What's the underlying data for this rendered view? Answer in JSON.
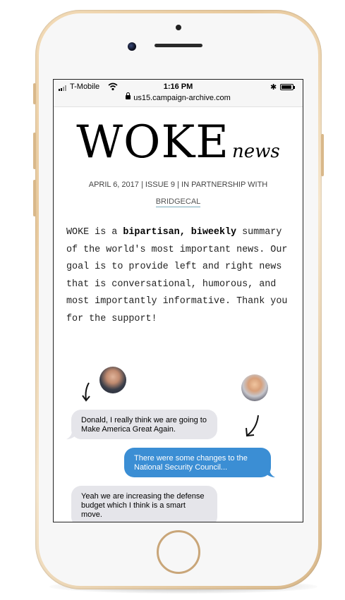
{
  "status_bar": {
    "carrier": "T-Mobile",
    "time": "1:16 PM",
    "url": "us15.campaign-archive.com",
    "battery_level": 0.9
  },
  "newsletter": {
    "logo_main": "WOKE",
    "logo_sub": "news",
    "dateline": "APRIL 6, 2017 | ISSUE 9 | IN PARTNERSHIP WITH",
    "partner_link": "BRIDGECAL",
    "intro_prefix": "WOKE is a ",
    "intro_bold": "bipartisan, biweekly",
    "intro_rest": " summary of the world's most important news. Our goal is to provide left and right news that is conversational, humorous, and most importantly informative. Thank you for the support!"
  },
  "chat": {
    "messages": [
      {
        "side": "left",
        "text": "Donald, I really think we are going to Make America Great Again."
      },
      {
        "side": "right",
        "text": "There were some changes to the National Security Council..."
      },
      {
        "side": "left",
        "text": "Yeah we are increasing the defense budget which I think is a smart move."
      }
    ]
  },
  "colors": {
    "sent_bubble": "#3b8ed4",
    "received_bubble": "#e5e5ea",
    "phone_frame": "#e8c99c"
  }
}
